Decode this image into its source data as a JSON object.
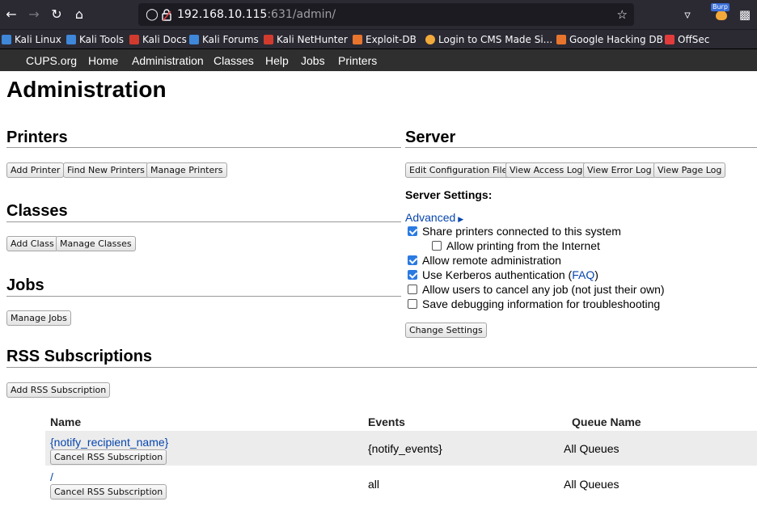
{
  "browser": {
    "url_host": "192.168.10.115",
    "url_rest": ":631/admin/",
    "icons": [
      "back-icon",
      "forward-icon",
      "reload-icon",
      "home-icon",
      "shield-icon",
      "lock-icon",
      "star-icon",
      "pocket-icon",
      "burp-icon",
      "extensions-icon"
    ],
    "burp_badge": "Burp",
    "bookmarks": [
      {
        "label": "Kali Linux",
        "color": "#3f87d9"
      },
      {
        "label": "Kali Tools",
        "color": "#3f87d9"
      },
      {
        "label": "Kali Docs",
        "color": "#d13b2e"
      },
      {
        "label": "Kali Forums",
        "color": "#3f87d9"
      },
      {
        "label": "Kali NetHunter",
        "color": "#d13b2e"
      },
      {
        "label": "Exploit-DB",
        "color": "#e8752d"
      },
      {
        "label": "Login to CMS Made Si...",
        "color": "#f2a93b"
      },
      {
        "label": "Google Hacking DB",
        "color": "#e8752d"
      },
      {
        "label": "OffSec",
        "color": "#e23b3b"
      }
    ]
  },
  "cups_nav": [
    "CUPS.org",
    "Home",
    "Administration",
    "Classes",
    "Help",
    "Jobs",
    "Printers"
  ],
  "page_title": "Administration",
  "printers": {
    "heading": "Printers",
    "buttons": [
      "Add Printer",
      "Find New Printers",
      "Manage Printers"
    ]
  },
  "classes": {
    "heading": "Classes",
    "buttons": [
      "Add Class",
      "Manage Classes"
    ]
  },
  "jobs": {
    "heading": "Jobs",
    "buttons": [
      "Manage Jobs"
    ]
  },
  "server": {
    "heading": "Server",
    "buttons": [
      "Edit Configuration File",
      "View Access Log",
      "View Error Log",
      "View Page Log"
    ],
    "settings_label": "Server Settings:",
    "advanced_label": "Advanced",
    "options": [
      {
        "label": "Share printers connected to this system",
        "checked": true
      },
      {
        "label": "Allow printing from the Internet",
        "checked": false
      },
      {
        "label": "Allow remote administration",
        "checked": true
      },
      {
        "label": "Use Kerberos authentication (",
        "link": "FAQ",
        "suffix": ")",
        "checked": true
      },
      {
        "label": "Allow users to cancel any job (not just their own)",
        "checked": false
      },
      {
        "label": "Save debugging information for troubleshooting",
        "checked": false
      }
    ],
    "change_button": "Change Settings"
  },
  "rss": {
    "heading": "RSS Subscriptions",
    "add_button": "Add RSS Subscription",
    "columns": [
      "Name",
      "Events",
      "Queue Name"
    ],
    "rows": [
      {
        "name": "{notify_recipient_name}",
        "cancel": "Cancel RSS Subscription",
        "events": "{notify_events}",
        "queue": "All Queues"
      },
      {
        "name": "/",
        "cancel": "Cancel RSS Subscription",
        "events": "all",
        "queue": "All Queues"
      }
    ]
  }
}
